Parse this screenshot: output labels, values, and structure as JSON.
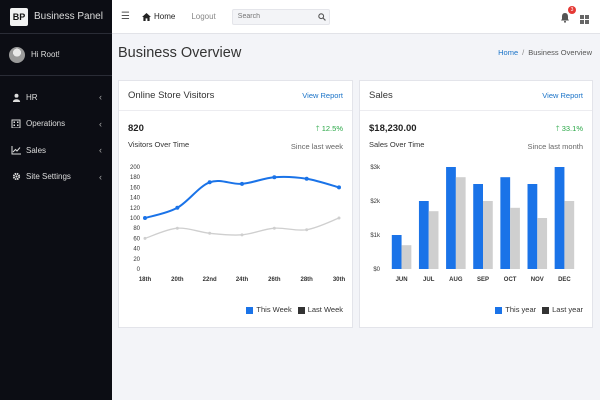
{
  "brand": {
    "logo": "BP",
    "name": "Business Panel"
  },
  "user": {
    "name": "Hi Root!"
  },
  "sidebar": {
    "items": [
      {
        "label": "HR",
        "icon": "user-icon"
      },
      {
        "label": "Operations",
        "icon": "building-icon"
      },
      {
        "label": "Sales",
        "icon": "line-chart-icon"
      },
      {
        "label": "Site Settings",
        "icon": "gear-icon"
      }
    ]
  },
  "topbar": {
    "home": "Home",
    "logout": "Logout",
    "search_placeholder": "Search",
    "notification_count": "3"
  },
  "page": {
    "title": "Business Overview"
  },
  "breadcrumb": {
    "home": "Home",
    "separator": "/",
    "current": "Business Overview"
  },
  "colors": {
    "primary": "#1a73e8",
    "secondary": "#cfcfcf",
    "sidebar": "#0c0d14",
    "success": "#28a745"
  },
  "visitors_card": {
    "title": "Online Store Visitors",
    "link": "View Report",
    "metric": "820",
    "metric_label": "Visitors Over Time",
    "change": "12.5%",
    "since": "Since last week"
  },
  "sales_card": {
    "title": "Sales",
    "link": "View Report",
    "metric": "$18,230.00",
    "metric_label": "Sales Over Time",
    "change": "33.1%",
    "since": "Since last month"
  },
  "chart_data": [
    {
      "type": "line",
      "categories": [
        "18th",
        "20th",
        "22nd",
        "24th",
        "26th",
        "28th",
        "30th"
      ],
      "series": [
        {
          "name": "This Week",
          "values": [
            100,
            120,
            170,
            167,
            180,
            177,
            160
          ],
          "color": "#1a73e8"
        },
        {
          "name": "Last Week",
          "values": [
            60,
            80,
            70,
            67,
            80,
            77,
            100
          ],
          "color": "#cfcfcf"
        }
      ],
      "ylim": [
        0,
        200
      ],
      "yticks": [
        0,
        20,
        40,
        60,
        80,
        100,
        120,
        140,
        160,
        180,
        200
      ],
      "legend": "bottom-right",
      "grid": false
    },
    {
      "type": "bar",
      "categories": [
        "JUN",
        "JUL",
        "AUG",
        "SEP",
        "OCT",
        "NOV",
        "DEC"
      ],
      "series": [
        {
          "name": "This year",
          "values": [
            1000,
            2000,
            3000,
            2500,
            2700,
            2500,
            3000
          ],
          "color": "#1a73e8"
        },
        {
          "name": "Last year",
          "values": [
            700,
            1700,
            2700,
            2000,
            1800,
            1500,
            2000
          ],
          "color": "#cfcfcf"
        }
      ],
      "ylim": [
        0,
        3000
      ],
      "yticks": [
        "$0",
        "$1k",
        "$2k",
        "$3k"
      ],
      "legend": "bottom-right",
      "grid": false
    }
  ]
}
